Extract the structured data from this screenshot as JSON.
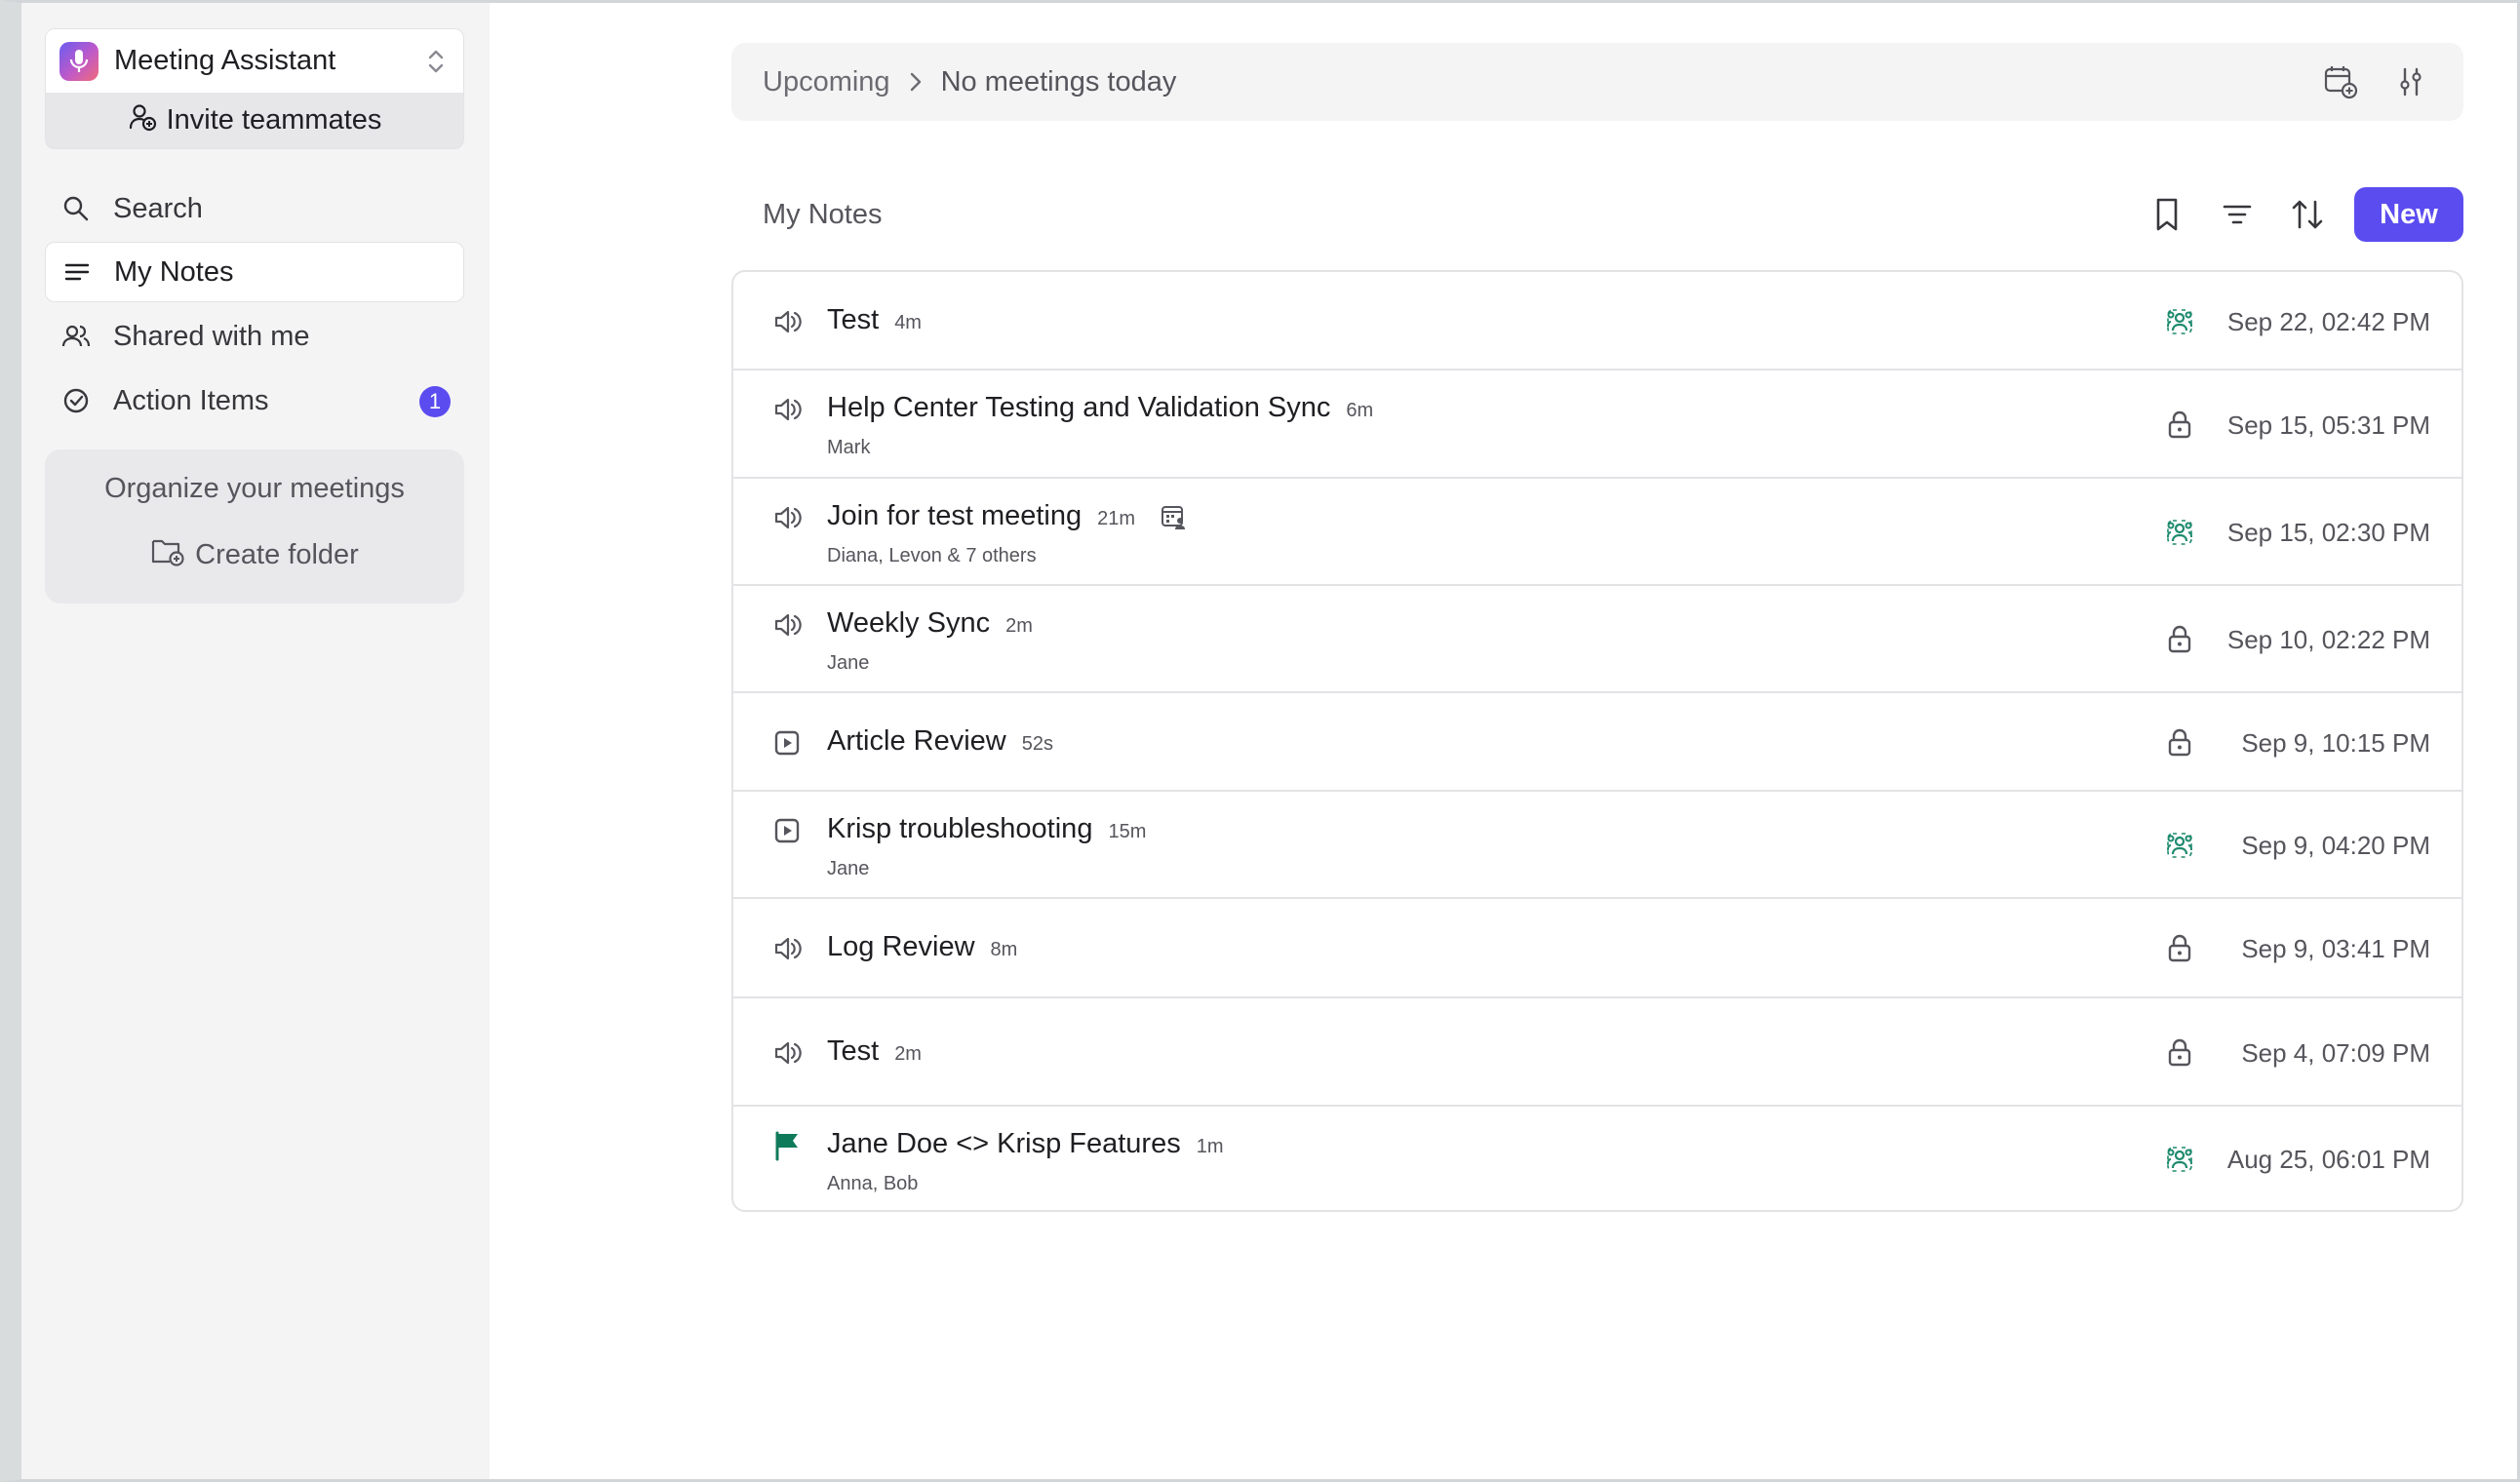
{
  "workspace": {
    "name": "Meeting Assistant",
    "invite_label": "Invite teammates"
  },
  "nav": {
    "search": "Search",
    "my_notes": "My Notes",
    "shared": "Shared with me",
    "action_items": "Action Items",
    "action_items_count": "1"
  },
  "folders": {
    "title": "Organize your meetings",
    "create_label": "Create folder"
  },
  "topbar": {
    "crumb": "Upcoming",
    "status": "No meetings today"
  },
  "notes": {
    "title": "My Notes",
    "new_label": "New",
    "items": [
      {
        "icon": "speaker-icon",
        "title": "Test",
        "duration": "4m",
        "participants": "",
        "status": "shared-icon",
        "date": "Sep 22, 02:42 PM"
      },
      {
        "icon": "speaker-icon",
        "title": "Help Center Testing and Validation Sync",
        "duration": "6m",
        "participants": "Mark",
        "status": "lock-icon",
        "date": "Sep 15, 05:31 PM"
      },
      {
        "icon": "speaker-icon",
        "title": "Join for test meeting",
        "duration": "21m",
        "participants": "Diana, Levon & 7 others",
        "status": "shared-icon",
        "date": "Sep 15, 02:30 PM",
        "calendar": true
      },
      {
        "icon": "speaker-icon",
        "title": "Weekly Sync",
        "duration": "2m",
        "participants": "Jane",
        "status": "lock-icon",
        "date": "Sep 10, 02:22 PM"
      },
      {
        "icon": "play-icon",
        "title": "Article Review",
        "duration": "52s",
        "participants": "",
        "status": "lock-icon",
        "date": "Sep 9, 10:15 PM"
      },
      {
        "icon": "play-icon",
        "title": "Krisp troubleshooting",
        "duration": "15m",
        "participants": "Jane",
        "status": "shared-icon",
        "date": "Sep 9, 04:20 PM"
      },
      {
        "icon": "speaker-icon",
        "title": "Log Review",
        "duration": "8m",
        "participants": "",
        "status": "lock-icon",
        "date": "Sep 9, 03:41 PM"
      },
      {
        "icon": "speaker-icon",
        "title": "Test",
        "duration": "2m",
        "participants": "",
        "status": "lock-icon",
        "date": "Sep 4, 07:09 PM"
      },
      {
        "icon": "flag-icon",
        "title": "Jane Doe <> Krisp Features",
        "duration": "1m",
        "participants": "Anna, Bob",
        "status": "shared-icon",
        "date": "Aug 25, 06:01 PM"
      }
    ]
  },
  "colors": {
    "accent": "#5b4cf0",
    "shared_green": "#1e8a6e",
    "flag_green": "#0f7a5a"
  }
}
